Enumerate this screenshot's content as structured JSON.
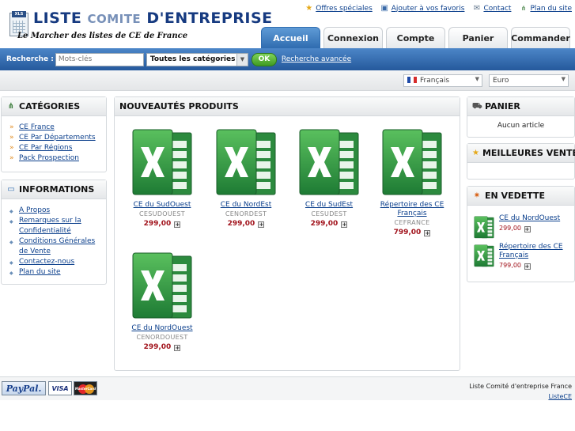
{
  "header": {
    "logo_badge": "XLS",
    "logo_title_1": "LISTE",
    "logo_title_2": "COMITE",
    "logo_title_3": "D'ENTREPRISE",
    "logo_subtitle": "Le Marcher des listes de CE de France",
    "links": [
      {
        "label": "Offres spéciales",
        "icon": "star-icon"
      },
      {
        "label": "Ajouter à vos favoris",
        "icon": "bookmark-icon"
      },
      {
        "label": "Contact",
        "icon": "mail-icon"
      },
      {
        "label": "Plan du site",
        "icon": "sitemap-icon"
      }
    ],
    "tabs": [
      "Accueil",
      "Connexion",
      "Compte",
      "Panier",
      "Commander"
    ],
    "active_tab": "Accueil"
  },
  "search": {
    "label": "Recherche :",
    "placeholder": "Mots-clés",
    "category": "Toutes les catégories",
    "ok": "OK",
    "advanced": "Recherche avancée"
  },
  "settings": {
    "language": "Français",
    "currency": "Euro"
  },
  "categories": {
    "title": "CATÉGORIES",
    "items": [
      "CE France",
      "CE Par Départements",
      "CE Par Régions",
      "Pack Prospection"
    ]
  },
  "informations": {
    "title": "INFORMATIONS",
    "items": [
      "A Propos",
      "Remarques sur la Confidentialité",
      "Conditions Générales de Vente",
      "Contactez-nous",
      "Plan du site"
    ]
  },
  "new_products": {
    "title": "NOUVEAUTÉS PRODUITS",
    "items": [
      {
        "name": "CE du SudOuest",
        "code": "CESUDOUEST",
        "price": "299,00"
      },
      {
        "name": "CE du NordEst",
        "code": "CENORDEST",
        "price": "299,00"
      },
      {
        "name": "CE du SudEst",
        "code": "CESUDEST",
        "price": "299,00"
      },
      {
        "name": "Répertoire des CE Français",
        "code": "CEFRANCE",
        "price": "799,00"
      },
      {
        "name": "CE du NordOuest",
        "code": "CENORDOUEST",
        "price": "299,00"
      }
    ]
  },
  "cart": {
    "title": "PANIER",
    "empty_text": "Aucun article"
  },
  "bestsellers": {
    "title": "MEILLEURES VENTES"
  },
  "featured": {
    "title": "EN VEDETTE",
    "items": [
      {
        "name": "CE du NordOuest",
        "price": "299,00"
      },
      {
        "name": "Répertoire des CE Français",
        "price": "799,00"
      }
    ]
  },
  "footer": {
    "payments": [
      "PayPal.",
      "VISA",
      "MasterCard"
    ],
    "company": "Liste Comité d'entreprise France",
    "link": "ListeCE"
  },
  "colors": {
    "accent_blue": "#2f6cb0",
    "excel_green": "#1e7b34",
    "price_red": "#a1121b"
  }
}
